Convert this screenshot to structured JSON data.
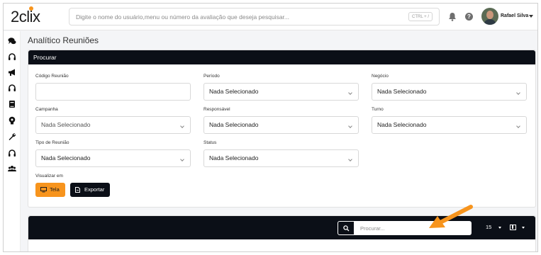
{
  "header": {
    "logo": "2clix",
    "search_placeholder": "Digite o nome do usuário,menu ou número da avaliação que deseja pesquisar...",
    "shortcut": "CTRL + /",
    "help_label": "?",
    "user_name": "Rafael Silva"
  },
  "sidebar": {
    "icons": [
      "chat-icon",
      "headset-icon",
      "megaphone-icon",
      "headset-icon",
      "book-icon",
      "lightbulb-icon",
      "wrench-icon",
      "headset-icon",
      "users-icon"
    ]
  },
  "page": {
    "title": "Analítico Reuniões"
  },
  "filters": {
    "section_title": "Procurar",
    "codigo_label": "Código Reunião",
    "codigo_value": "",
    "periodo_label": "Período",
    "periodo_value": "Nada Selecionado",
    "negocio_label": "Negócio",
    "negocio_value": "Nada Selecionado",
    "campanha_label": "Campanha",
    "campanha_value": "Nada Selecionado",
    "responsavel_label": "Responsável",
    "responsavel_value": "Nada Selecionado",
    "turno_label": "Turno",
    "turno_value": "Nada Selecionado",
    "tipo_label": "Tipo de Reunião",
    "tipo_value": "Nada Selecionado",
    "status_label": "Status",
    "status_value": "Nada Selecionado",
    "visualizar_label": "Visualizar em",
    "tela_button": "Tela",
    "exportar_button": "Exportar"
  },
  "table_toolbar": {
    "search_placeholder": "Procurar...",
    "page_size": "15"
  },
  "colors": {
    "accent": "#f7941d",
    "dark": "#0b0f17"
  }
}
